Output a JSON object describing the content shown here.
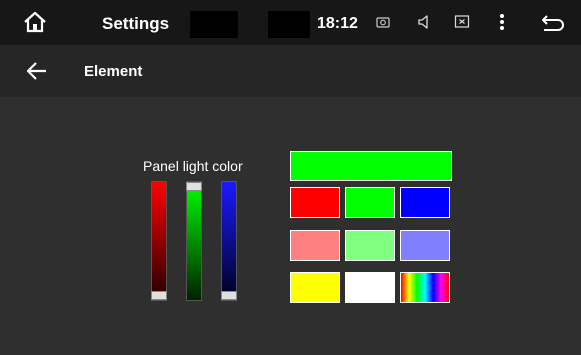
{
  "statusbar": {
    "title": "Settings",
    "time": "18:12",
    "icons": [
      "home-icon",
      "camera-icon",
      "volume-icon",
      "close-box-icon",
      "menu-dots-icon",
      "back-return-icon"
    ]
  },
  "header": {
    "title": "Element",
    "back_icon": "arrow-left-icon"
  },
  "panel": {
    "label": "Panel light color",
    "current_color": "#00ff00",
    "sliders": [
      {
        "channel": "red",
        "value": 0
      },
      {
        "channel": "green",
        "value": 1
      },
      {
        "channel": "blue",
        "value": 0
      }
    ]
  },
  "swatches": [
    {
      "name": "swatch-red",
      "color": "#ff0000"
    },
    {
      "name": "swatch-green",
      "color": "#00ff00"
    },
    {
      "name": "swatch-blue",
      "color": "#0000ff"
    },
    {
      "name": "swatch-light-red",
      "color": "#ff8080"
    },
    {
      "name": "swatch-light-green",
      "color": "#80ff80"
    },
    {
      "name": "swatch-light-blue",
      "color": "#8080ff"
    },
    {
      "name": "swatch-yellow",
      "color": "#ffff00"
    },
    {
      "name": "swatch-white",
      "color": "#ffffff"
    },
    {
      "name": "swatch-rainbow",
      "color": "rainbow"
    }
  ]
}
